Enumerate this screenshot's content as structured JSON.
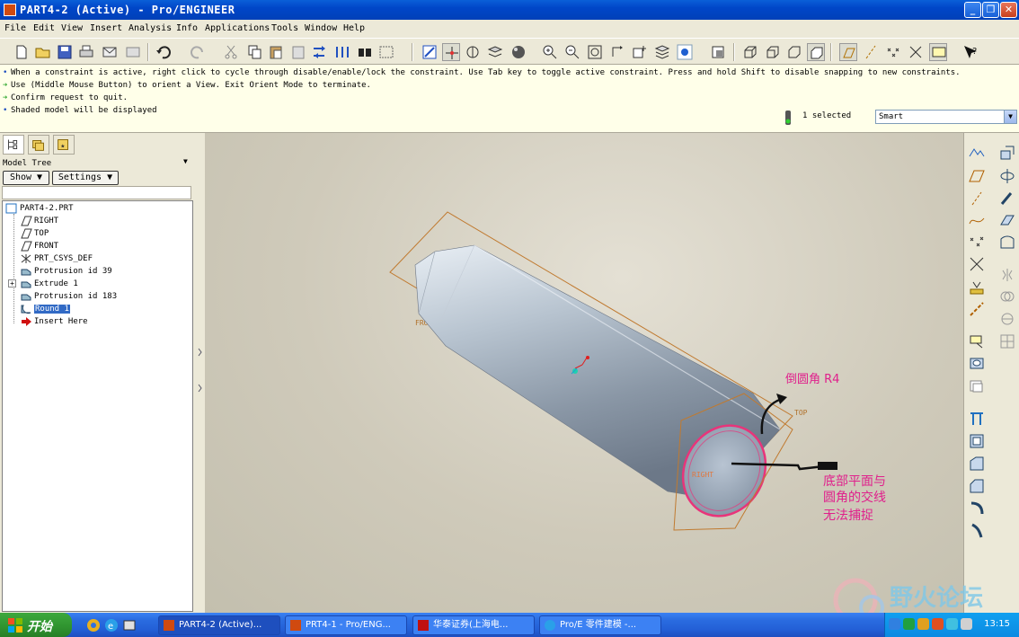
{
  "window": {
    "title": "PART4-2 (Active) - Pro/ENGINEER",
    "minimize_icon": "minimize-icon",
    "maximize_icon": "restore-icon",
    "close_icon": "close-icon"
  },
  "menu": [
    "File",
    "Edit",
    "View",
    "Insert",
    "Analysis",
    "Info",
    "Applications",
    "Tools",
    "Window",
    "Help"
  ],
  "messages": [
    {
      "icon": "info-bullet",
      "text": "When a constraint is active, right click to cycle through disable/enable/lock the constraint. Use Tab key to toggle active constraint. Press and hold Shift to disable snapping to new constraints."
    },
    {
      "icon": "green-arrow",
      "text": "Use (Middle Mouse Button) to orient a   View.   Exit Orient Mode to terminate."
    },
    {
      "icon": "green-arrow",
      "text": "Confirm request to quit."
    },
    {
      "icon": "info-bullet",
      "text": "Shaded model will be displayed"
    }
  ],
  "selection": {
    "count_text": "1 selected",
    "filter": "Smart"
  },
  "navigator": {
    "label": "Model Tree",
    "show_label": "Show ▼",
    "settings_label": "Settings ▼",
    "tree": [
      {
        "label": "PART4-2.PRT",
        "icon": "part-icon"
      },
      {
        "label": "RIGHT",
        "icon": "datum-plane-icon"
      },
      {
        "label": "TOP",
        "icon": "datum-plane-icon"
      },
      {
        "label": "FRONT",
        "icon": "datum-plane-icon"
      },
      {
        "label": "PRT_CSYS_DEF",
        "icon": "csys-icon"
      },
      {
        "label": "Protrusion id 39",
        "icon": "protrusion-icon"
      },
      {
        "label": "Extrude 1",
        "icon": "extrude-icon"
      },
      {
        "label": "Protrusion id 183",
        "icon": "protrusion-icon"
      },
      {
        "label": "Round 1",
        "icon": "round-icon",
        "selected": true
      },
      {
        "label": "Insert Here",
        "icon": "insert-here-arrow-icon"
      }
    ]
  },
  "viewport": {
    "datum_labels": {
      "front": "FRONT",
      "top": "TOP",
      "right": "RIGHT"
    },
    "annotation_round": "倒圆角 R4",
    "annotation_note": [
      "底部平面与",
      "圆角的交线",
      "无法捕捉"
    ],
    "annotation_color": "#e0208c"
  },
  "taskbar": {
    "start_label": "开始",
    "tasks": [
      {
        "label": "PART4-2 (Active)...",
        "active": true
      },
      {
        "label": "PRT4-1 - Pro/ENG..."
      },
      {
        "label": "华泰证券(上海电..."
      },
      {
        "label": "Pro/E 零件建模 -..."
      }
    ],
    "clock": "13:15"
  },
  "watermark": "野火论坛"
}
